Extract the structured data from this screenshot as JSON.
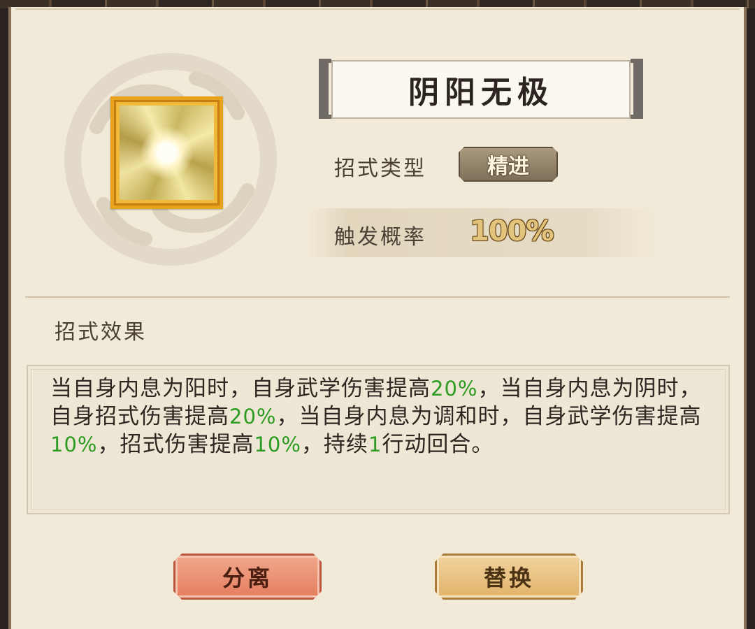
{
  "skill": {
    "name": "阴阳无极",
    "icon": "yin-yang-swirl-icon",
    "type_label": "招式类型",
    "type_value": "精进",
    "rate_label": "触发概率",
    "rate_value": "100%"
  },
  "effect": {
    "heading": "招式效果",
    "segments": [
      {
        "text": "当自身内息为阳时，自身武学伤害提高",
        "highlight": false
      },
      {
        "text": "20%",
        "highlight": true
      },
      {
        "text": "，当自身内息为阴时，自身招式伤害提高",
        "highlight": false
      },
      {
        "text": "20%",
        "highlight": true
      },
      {
        "text": "，当自身内息为调和时，自身武学伤害提高",
        "highlight": false
      },
      {
        "text": "10%",
        "highlight": true
      },
      {
        "text": "，招式伤害提高",
        "highlight": false
      },
      {
        "text": "10%",
        "highlight": true
      },
      {
        "text": "，持续",
        "highlight": false
      },
      {
        "text": "1",
        "highlight": true
      },
      {
        "text": "行动回合。",
        "highlight": false
      }
    ]
  },
  "buttons": {
    "separate": "分离",
    "replace": "替换"
  },
  "colors": {
    "highlight": "#2c9b22",
    "panel_bg": "#f2ead8",
    "icon_frame": "#e8a21c"
  }
}
